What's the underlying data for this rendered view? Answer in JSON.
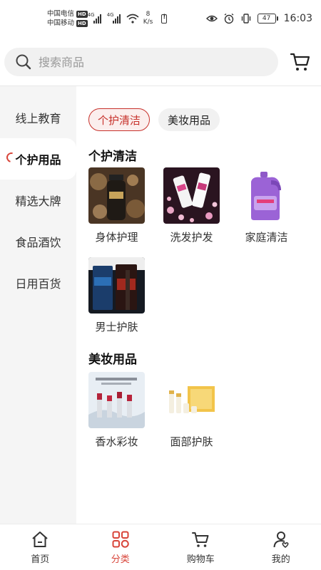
{
  "status_bar": {
    "carrier1": "中国电信",
    "carrier2": "中国移动",
    "hd": "HD",
    "net1": "4G",
    "net2": "4G",
    "speed_value": "8",
    "speed_unit": "K/s",
    "battery_level": "47",
    "time": "16:03"
  },
  "search": {
    "placeholder": "搜索商品",
    "icon": "search-icon"
  },
  "header": {
    "cart_icon": "cart-icon"
  },
  "sidebar": {
    "items": [
      {
        "label": "线上教育",
        "active": false
      },
      {
        "label": "个护用品",
        "active": true
      },
      {
        "label": "精选大牌",
        "active": false
      },
      {
        "label": "食品酒饮",
        "active": false
      },
      {
        "label": "日用百货",
        "active": false
      }
    ]
  },
  "subtabs": [
    {
      "label": "个护清洁",
      "active": true
    },
    {
      "label": "美妆用品",
      "active": false
    }
  ],
  "sections": [
    {
      "title": "个护清洁",
      "items": [
        {
          "label": "身体护理",
          "thumb": "body-wash-bottle-image"
        },
        {
          "label": "洗发护发",
          "thumb": "shampoo-bottles-image"
        },
        {
          "label": "家庭清洁",
          "thumb": "laundry-detergent-image"
        },
        {
          "label": "男士护肤",
          "thumb": "mens-skincare-tubes-image"
        }
      ]
    },
    {
      "title": "美妆用品",
      "items": [
        {
          "label": "香水彩妆",
          "thumb": "lipsticks-image"
        },
        {
          "label": "面部护肤",
          "thumb": "face-care-set-image"
        }
      ]
    }
  ],
  "bottom_nav": [
    {
      "label": "首页",
      "icon": "home-icon",
      "active": false
    },
    {
      "label": "分类",
      "icon": "category-icon",
      "active": true
    },
    {
      "label": "购物车",
      "icon": "cart-icon",
      "active": false
    },
    {
      "label": "我的",
      "icon": "profile-icon",
      "active": false
    }
  ],
  "colors": {
    "accent": "#d8453a",
    "tab_active": "#c7312b",
    "sidebar_bg": "#f5f5f5"
  }
}
